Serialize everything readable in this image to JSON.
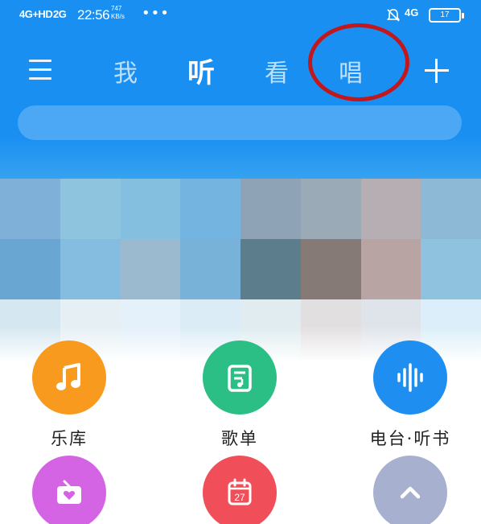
{
  "status_bar": {
    "signal_1": "4G+HD",
    "signal_2": "2G",
    "time": "22:56",
    "speed_value": "747",
    "speed_unit": "KB/s",
    "more": "•••",
    "network_right": "4G",
    "battery_level": "17",
    "icons": [
      "signal-icon",
      "bell-muted-icon",
      "battery-icon"
    ]
  },
  "header": {
    "tabs": [
      {
        "label": "我"
      },
      {
        "label": "听",
        "active": true
      },
      {
        "label": "看"
      },
      {
        "label": "唱"
      }
    ],
    "annotation_color": "#c0181c",
    "accent_color": "#1a8ff2"
  },
  "features": [
    {
      "label": "乐库",
      "icon": "music-note-icon",
      "color": "#f79a1e"
    },
    {
      "label": "歌单",
      "icon": "playlist-icon",
      "color": "#2bbf86"
    },
    {
      "label": "电台·听书",
      "icon": "sound-wave-icon",
      "color": "#1e8ef0"
    }
  ],
  "features_row2": [
    {
      "icon": "radio-heart-icon",
      "color": "#d564e5"
    },
    {
      "icon": "calendar-icon",
      "color": "#f04e59",
      "day": "27"
    },
    {
      "icon": "chevron-up-icon",
      "color": "#a8b0cf"
    }
  ]
}
